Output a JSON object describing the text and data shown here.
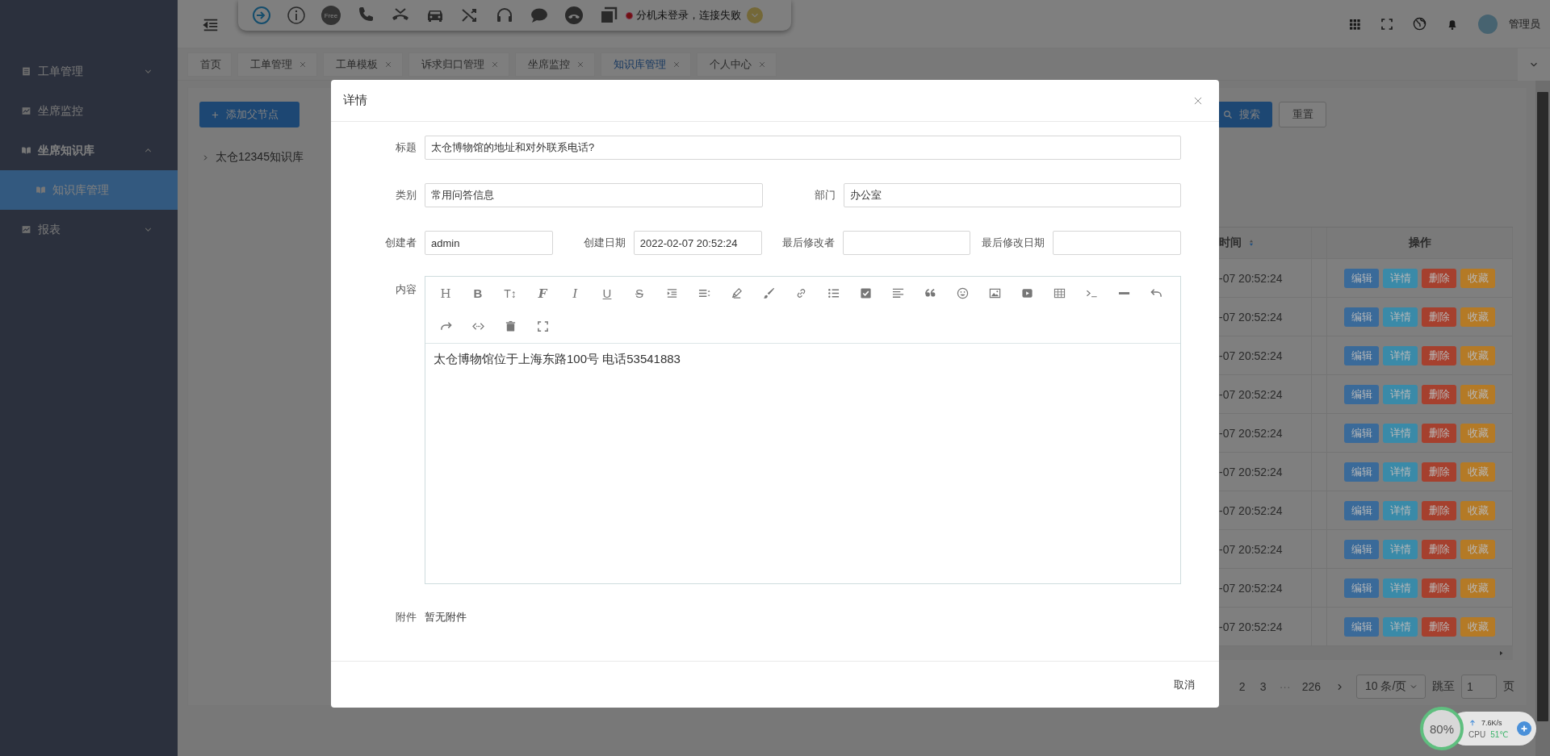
{
  "header": {
    "free_label": "Free",
    "status_text": "分机未登录，连接失败",
    "user_name": "管理员"
  },
  "sidebar": {
    "items": [
      {
        "label": "工单管理",
        "kind": "group",
        "expanded": false,
        "selected": false
      },
      {
        "label": "坐席监控",
        "kind": "link",
        "selected": false
      },
      {
        "label": "坐席知识库",
        "kind": "group",
        "expanded": true,
        "selected": false,
        "children": [
          {
            "label": "知识库管理",
            "selected": true
          }
        ]
      },
      {
        "label": "报表",
        "kind": "group",
        "expanded": false,
        "selected": false
      }
    ]
  },
  "tabs": [
    {
      "label": "首页",
      "closable": false,
      "selected": false
    },
    {
      "label": "工单管理",
      "closable": true,
      "selected": false
    },
    {
      "label": "工单模板",
      "closable": true,
      "selected": false
    },
    {
      "label": "诉求归口管理",
      "closable": true,
      "selected": false
    },
    {
      "label": "坐席监控",
      "closable": true,
      "selected": false
    },
    {
      "label": "知识库管理",
      "closable": true,
      "selected": true
    },
    {
      "label": "个人中心",
      "closable": true,
      "selected": false
    }
  ],
  "content": {
    "add_button": "添加父节点",
    "tree": [
      {
        "label": "太仓12345知识库",
        "expanded": false
      }
    ],
    "search_button": "搜索",
    "reset_button": "重置",
    "table": {
      "columns": [
        "时间",
        "操作"
      ],
      "rows": [
        {
          "time": "-07 20:52:24",
          "actions": [
            {
              "label": "编辑",
              "color": "#3a6a99"
            },
            {
              "label": "详情",
              "color": "#3a8aa8"
            },
            {
              "label": "删除",
              "color": "#a5402e"
            },
            {
              "label": "收藏",
              "color": "#b47a26"
            }
          ]
        },
        {
          "time": "-07 20:52:24",
          "actions": [
            {
              "label": "编辑",
              "color": "#3a6a99"
            },
            {
              "label": "详情",
              "color": "#3a8aa8"
            },
            {
              "label": "删除",
              "color": "#a5402e"
            },
            {
              "label": "收藏",
              "color": "#b47a26"
            }
          ]
        },
        {
          "time": "-07 20:52:24",
          "actions": [
            {
              "label": "编辑",
              "color": "#3a6a99"
            },
            {
              "label": "详情",
              "color": "#3a8aa8"
            },
            {
              "label": "删除",
              "color": "#a5402e"
            },
            {
              "label": "收藏",
              "color": "#b47a26"
            }
          ]
        },
        {
          "time": "-07 20:52:24",
          "actions": [
            {
              "label": "编辑",
              "color": "#3a6a99"
            },
            {
              "label": "详情",
              "color": "#3a8aa8"
            },
            {
              "label": "删除",
              "color": "#a5402e"
            },
            {
              "label": "收藏",
              "color": "#b47a26"
            }
          ]
        },
        {
          "time": "-07 20:52:24",
          "actions": [
            {
              "label": "编辑",
              "color": "#3a6a99"
            },
            {
              "label": "详情",
              "color": "#3a8aa8"
            },
            {
              "label": "删除",
              "color": "#a5402e"
            },
            {
              "label": "收藏",
              "color": "#b47a26"
            }
          ]
        },
        {
          "time": "-07 20:52:24",
          "actions": [
            {
              "label": "编辑",
              "color": "#3a6a99"
            },
            {
              "label": "详情",
              "color": "#3a8aa8"
            },
            {
              "label": "删除",
              "color": "#a5402e"
            },
            {
              "label": "收藏",
              "color": "#b47a26"
            }
          ]
        },
        {
          "time": "-07 20:52:24",
          "actions": [
            {
              "label": "编辑",
              "color": "#3a6a99"
            },
            {
              "label": "详情",
              "color": "#3a8aa8"
            },
            {
              "label": "删除",
              "color": "#a5402e"
            },
            {
              "label": "收藏",
              "color": "#b47a26"
            }
          ]
        },
        {
          "time": "-07 20:52:24",
          "actions": [
            {
              "label": "编辑",
              "color": "#3a6a99"
            },
            {
              "label": "详情",
              "color": "#3a8aa8"
            },
            {
              "label": "删除",
              "color": "#a5402e"
            },
            {
              "label": "收藏",
              "color": "#b47a26"
            }
          ]
        },
        {
          "time": "-07 20:52:24",
          "actions": [
            {
              "label": "编辑",
              "color": "#3a6a99"
            },
            {
              "label": "详情",
              "color": "#3a8aa8"
            },
            {
              "label": "删除",
              "color": "#a5402e"
            },
            {
              "label": "收藏",
              "color": "#b47a26"
            }
          ]
        },
        {
          "time": "-07 20:52:24",
          "actions": [
            {
              "label": "编辑",
              "color": "#3a6a99"
            },
            {
              "label": "详情",
              "color": "#3a8aa8"
            },
            {
              "label": "删除",
              "color": "#a5402e"
            },
            {
              "label": "收藏",
              "color": "#b47a26"
            }
          ]
        }
      ]
    },
    "pagination": {
      "pages": [
        {
          "kind": "page",
          "label": "2"
        },
        {
          "kind": "page",
          "label": "3"
        },
        {
          "kind": "ellipsis",
          "label": "···"
        },
        {
          "kind": "page",
          "label": "226"
        }
      ],
      "page_size": "10 条/页",
      "jump_label": "跳至",
      "jump_value": "1",
      "page_suffix": "页"
    }
  },
  "widget": {
    "percent": "80%",
    "speed": "7.6K/s",
    "cpu_label": "CPU",
    "cpu_temp": "51℃"
  },
  "modal": {
    "title": "详情",
    "rows": [
      {
        "fields": [
          {
            "label": "标题",
            "value": "太仓博物馆的地址和对外联系电话?"
          }
        ]
      },
      {
        "fields": [
          {
            "label": "类别",
            "value": "常用问答信息"
          },
          {
            "label": "部门",
            "value": "办公室"
          }
        ]
      },
      {
        "fields": [
          {
            "label": "创建者",
            "value": "admin"
          },
          {
            "label": "创建日期",
            "value": "2022-02-07 20:52:24"
          },
          {
            "label": "最后修改者"
          },
          {
            "label": "最后修改日期"
          }
        ]
      }
    ],
    "content_label": "内容",
    "editor_toolbar": [
      {
        "kind": "heading",
        "label": "H"
      },
      {
        "kind": "bold",
        "label": "B"
      },
      {
        "kind": "size",
        "label": "T↕"
      },
      {
        "kind": "font",
        "label": "F"
      },
      {
        "kind": "italic",
        "label": "I"
      },
      {
        "kind": "underline",
        "label": "U"
      },
      {
        "kind": "strike",
        "label": "S"
      },
      {
        "kind": "indent"
      },
      {
        "kind": "line-height"
      },
      {
        "kind": "pen"
      },
      {
        "kind": "brush"
      },
      {
        "kind": "link"
      },
      {
        "kind": "list"
      },
      {
        "kind": "checkbox"
      },
      {
        "kind": "align-left"
      },
      {
        "kind": "quote"
      },
      {
        "kind": "emoji"
      },
      {
        "kind": "image"
      },
      {
        "kind": "video"
      },
      {
        "kind": "table"
      },
      {
        "kind": "terminal"
      },
      {
        "kind": "horizontal-rule"
      },
      {
        "kind": "undo"
      },
      {
        "kind": "redo"
      },
      {
        "kind": "code"
      },
      {
        "kind": "trash"
      },
      {
        "kind": "fullscreen"
      }
    ],
    "content": "太仓博物馆位于上海东路100号 电话53541883",
    "attachment_label": "附件",
    "attachment_text": "暂无附件",
    "cancel_button": "取消"
  }
}
